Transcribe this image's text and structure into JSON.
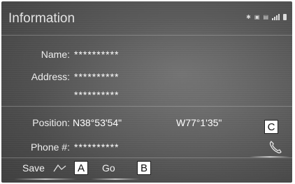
{
  "header": {
    "title": "Information"
  },
  "status_icons": [
    "bluetooth-icon",
    "vehicle-signal-icon",
    "data-signal-icon",
    "signal-strength-icon",
    "battery-icon"
  ],
  "fields": {
    "name": {
      "label": "Name:",
      "value": "**********"
    },
    "address": {
      "label": "Address:",
      "value_line1": "**********",
      "value_line2": "**********"
    },
    "position": {
      "label": "Position:",
      "latitude": "N38°53'54\"",
      "longitude": "W77°1'35\""
    },
    "phone": {
      "label": "Phone #:",
      "value": "**********"
    }
  },
  "actions": {
    "save_label": "Save",
    "go_label": "Go"
  },
  "callouts": {
    "a": "A",
    "b": "B",
    "c": "C"
  }
}
